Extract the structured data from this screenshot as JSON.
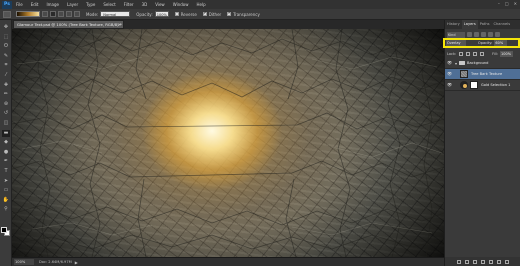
{
  "app": {
    "logo": "Ps",
    "menus": [
      "File",
      "Edit",
      "Image",
      "Layer",
      "Type",
      "Select",
      "Filter",
      "3D",
      "View",
      "Window",
      "Help"
    ],
    "window_controls": [
      "–",
      "□",
      "✕"
    ]
  },
  "options_bar": {
    "mode_label": "Mode:",
    "mode_value": "Normal",
    "opacity_label": "Opacity:",
    "opacity_value": "100%",
    "checkboxes": [
      {
        "label": "Reverse",
        "checked": false
      },
      {
        "label": "Dither",
        "checked": true
      },
      {
        "label": "Transparency",
        "checked": true
      }
    ]
  },
  "toolbar": {
    "tools": [
      "move-tool",
      "marquee-tool",
      "lasso-tool",
      "quick-select-tool",
      "crop-tool",
      "eyedropper-tool",
      "healing-tool",
      "brush-tool",
      "clone-stamp-tool",
      "history-brush-tool",
      "eraser-tool",
      "gradient-tool",
      "blur-tool",
      "dodge-tool",
      "pen-tool",
      "type-tool",
      "path-select-tool",
      "shape-tool",
      "hand-tool",
      "zoom-tool"
    ],
    "tool_glyphs": [
      "✥",
      "⬚",
      "ʘ",
      "✎",
      "⌗",
      "⁄",
      "✚",
      "✏",
      "⊛",
      "↺",
      "◫",
      "▬",
      "◆",
      "●",
      "✒",
      "T",
      "➤",
      "▭",
      "✋",
      "⚲"
    ],
    "active_tool": "gradient-tool",
    "foreground_color": "#000000",
    "background_color": "#ffffff"
  },
  "document": {
    "tab_title": "Glamour Text.psd @ 100% (Tree Bark Texture, RGB/8) *",
    "close_glyph": "×"
  },
  "status": {
    "zoom": "100%",
    "doc_info": "Doc: 2.64M/6.97M",
    "arrow": "▶"
  },
  "panels": {
    "tabs": [
      "History",
      "Layers",
      "Paths",
      "Channels"
    ],
    "active_tab": "Layers",
    "kind_filter": "Kind",
    "blend_mode": "Overlay",
    "opacity_label": "Opacity:",
    "opacity_value": "60%",
    "lock_label": "Lock:",
    "fill_label": "Fill:",
    "fill_value": "100%",
    "layers": [
      {
        "name": "Background",
        "type": "group",
        "visible": true,
        "selected": false
      },
      {
        "name": "Tree Bark Texture",
        "type": "texture",
        "visible": true,
        "selected": true
      },
      {
        "name": "Gold Selection 1",
        "type": "adjustment",
        "visible": true,
        "selected": false
      }
    ]
  },
  "colors": {
    "highlight_border": "#f4e50a",
    "selected_layer": "#4f6f96",
    "glow_center": "#fff6d8",
    "glow_gold": "#e3b35a"
  }
}
